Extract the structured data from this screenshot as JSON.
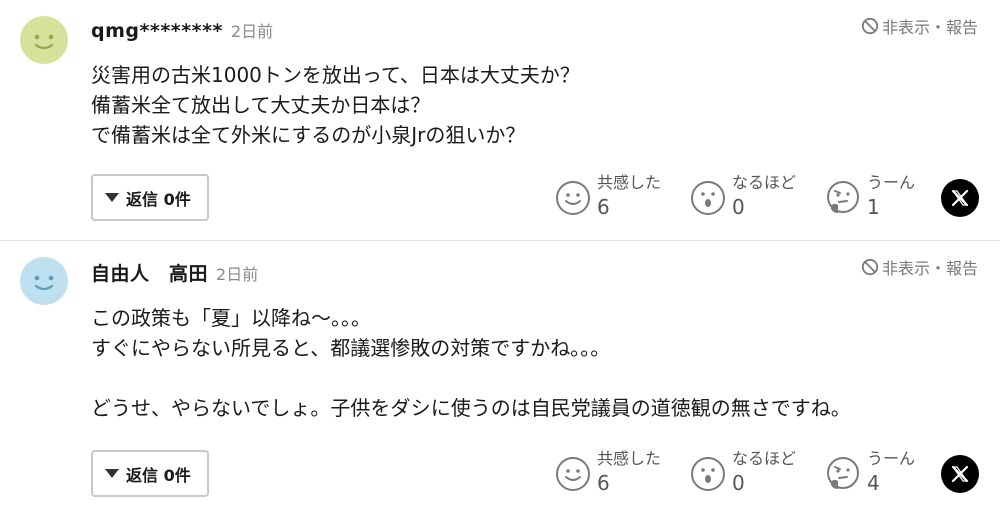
{
  "comments": [
    {
      "username": "qmg********",
      "time": "2日前",
      "avatar_color": "#d6e29a",
      "report_label": "非表示・報告",
      "lines": [
        "災害用の古米1000トンを放出って、日本は大丈夫か？",
        "備蓄米全て放出して大丈夫か日本は？",
        "で備蓄米は全て外米にするのが小泉Jrの狙いか？"
      ],
      "reply_label": "返信 0件",
      "reactions": [
        {
          "label": "共感した",
          "count": "6",
          "icon": "smile-face-icon"
        },
        {
          "label": "なるほど",
          "count": "0",
          "icon": "surprised-face-icon"
        },
        {
          "label": "うーん",
          "count": "1",
          "icon": "thinking-face-icon"
        }
      ]
    },
    {
      "username": "自由人　高田",
      "time": "2日前",
      "avatar_color": "#bfe0ef",
      "report_label": "非表示・報告",
      "lines": [
        "この政策も「夏」以降ね〜。。。",
        "すぐにやらない所見ると、都議選惨敗の対策ですかね。。。",
        "",
        "どうせ、やらないでしょ。子供をダシに使うのは自民党議員の道徳観の無さですね。"
      ],
      "reply_label": "返信 0件",
      "reactions": [
        {
          "label": "共感した",
          "count": "6",
          "icon": "smile-face-icon"
        },
        {
          "label": "なるほど",
          "count": "0",
          "icon": "surprised-face-icon"
        },
        {
          "label": "うーん",
          "count": "4",
          "icon": "thinking-face-icon"
        }
      ]
    }
  ],
  "colors": {
    "icon_gray": "#7a7a7a",
    "x_button": "#000000"
  }
}
